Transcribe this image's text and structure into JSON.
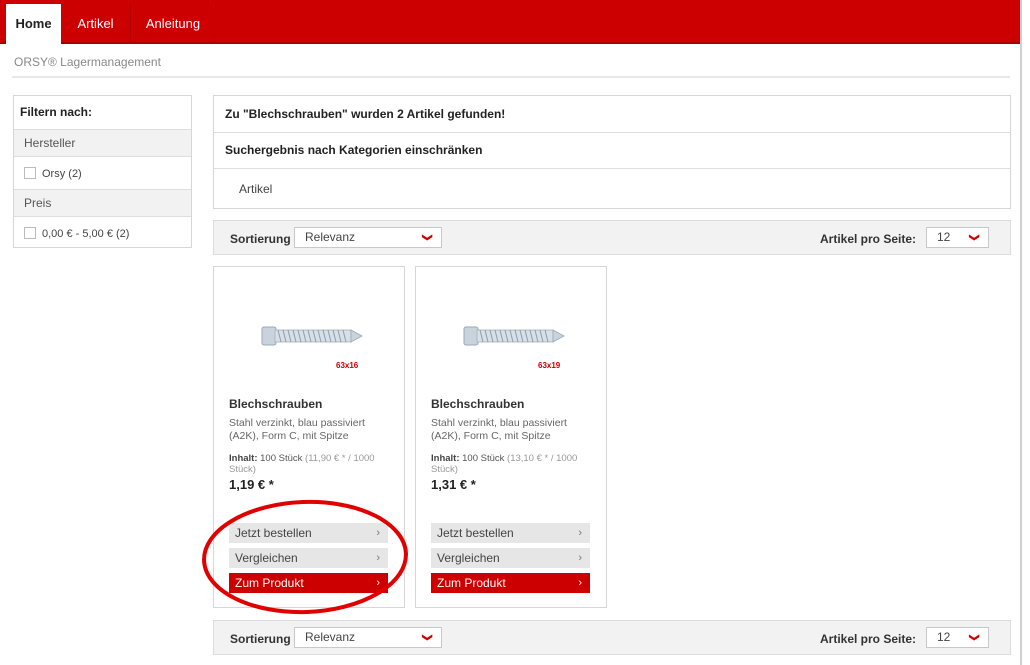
{
  "nav": {
    "tabs": [
      {
        "label": "Home",
        "active": true
      },
      {
        "label": "Artikel",
        "active": false
      },
      {
        "label": "Anleitung",
        "active": false
      }
    ]
  },
  "brand": "ORSY® Lagermanagement",
  "filter": {
    "title": "Filtern nach:",
    "groups": [
      {
        "label": "Hersteller",
        "options": [
          {
            "label": "Orsy (2)",
            "checked": false
          }
        ]
      },
      {
        "label": "Preis",
        "options": [
          {
            "label": "0,00 € - 5,00 € (2)",
            "checked": false
          }
        ]
      }
    ]
  },
  "results": {
    "found_text": "Zu \"Blechschrauben\" wurden 2 Artikel gefunden!",
    "restrict_text": "Suchergebnis nach Kategorien einschränken",
    "category": "Artikel"
  },
  "sort": {
    "label": "Sortierung",
    "value": "Relevanz",
    "per_page_label": "Artikel pro Seite:",
    "per_page_value": "12"
  },
  "products": [
    {
      "title": "Blechschrauben",
      "description": "Stahl verzinkt, blau passiviert (A2K), Form C, mit Spitze",
      "content_label": "Inhalt:",
      "content_value": "100 Stück",
      "unit_price": "(11,90 € * / 1000 Stück)",
      "price": "1,19 € *",
      "size_tag": "63x16",
      "buttons": {
        "order": "Jetzt bestellen",
        "compare": "Vergleichen",
        "product": "Zum Produkt"
      }
    },
    {
      "title": "Blechschrauben",
      "description": "Stahl verzinkt, blau passiviert (A2K), Form C, mit Spitze",
      "content_label": "Inhalt:",
      "content_value": "100 Stück",
      "unit_price": "(13,10 € * / 1000 Stück)",
      "price": "1,31 € *",
      "size_tag": "63x19",
      "buttons": {
        "order": "Jetzt bestellen",
        "compare": "Vergleichen",
        "product": "Zum Produkt"
      }
    }
  ],
  "colors": {
    "brand_red": "#cc0000",
    "annotation_red": "#e00000",
    "button_gray": "#e6e6e6"
  },
  "icons": {
    "dropdown": "chevron-down-icon",
    "button_arrow": "chevron-right-icon"
  }
}
